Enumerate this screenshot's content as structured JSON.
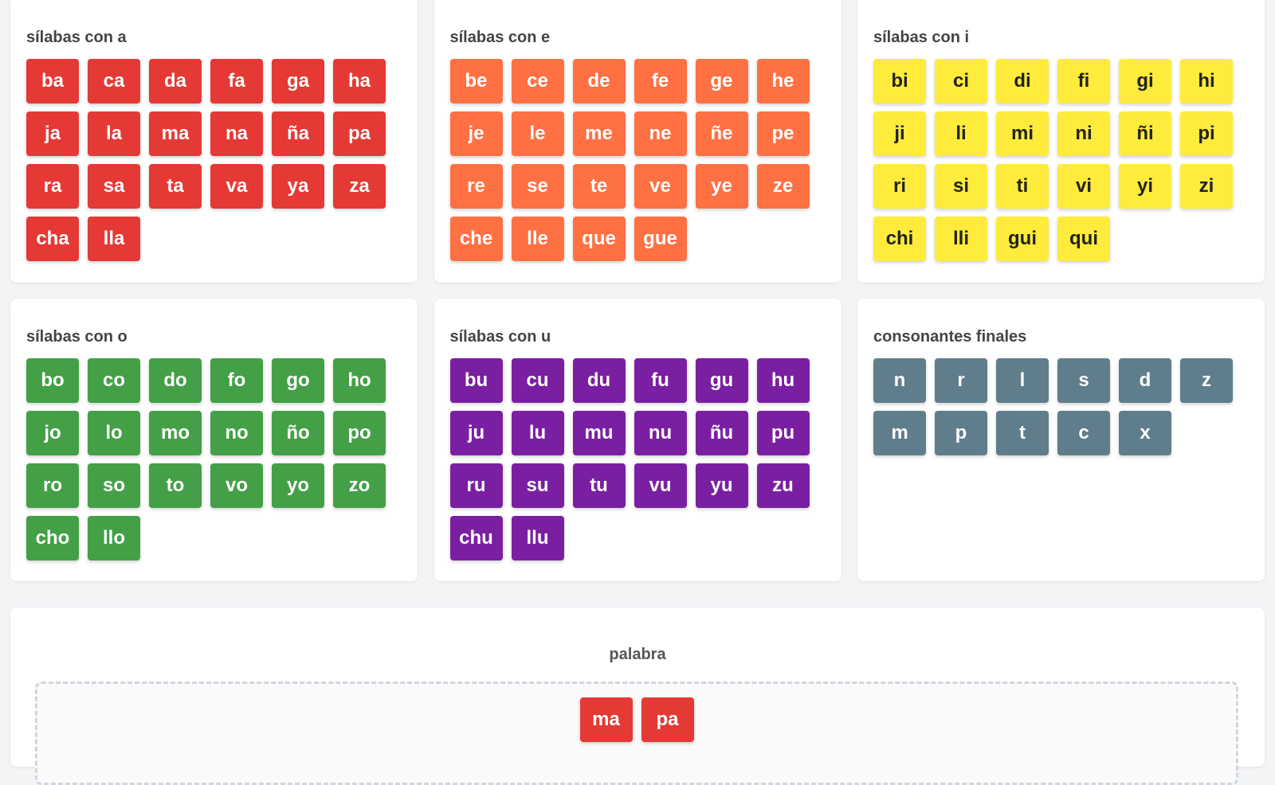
{
  "groups": [
    {
      "title": "sílabas con a",
      "color": "#e53935",
      "text_color": "#ffffff",
      "syllables": [
        "ba",
        "ca",
        "da",
        "fa",
        "ga",
        "ha",
        "ja",
        "la",
        "ma",
        "na",
        "ña",
        "pa",
        "ra",
        "sa",
        "ta",
        "va",
        "ya",
        "za",
        "cha",
        "lla"
      ]
    },
    {
      "title": "sílabas con e",
      "color": "#ff7043",
      "text_color": "#ffffff",
      "syllables": [
        "be",
        "ce",
        "de",
        "fe",
        "ge",
        "he",
        "je",
        "le",
        "me",
        "ne",
        "ñe",
        "pe",
        "re",
        "se",
        "te",
        "ve",
        "ye",
        "ze",
        "che",
        "lle",
        "que",
        "gue"
      ]
    },
    {
      "title": "sílabas con i",
      "color": "#ffeb3b",
      "text_color": "#222222",
      "syllables": [
        "bi",
        "ci",
        "di",
        "fi",
        "gi",
        "hi",
        "ji",
        "li",
        "mi",
        "ni",
        "ñi",
        "pi",
        "ri",
        "si",
        "ti",
        "vi",
        "yi",
        "zi",
        "chi",
        "lli",
        "gui",
        "qui"
      ]
    },
    {
      "title": "sílabas con o",
      "color": "#43a047",
      "text_color": "#ffffff",
      "syllables": [
        "bo",
        "co",
        "do",
        "fo",
        "go",
        "ho",
        "jo",
        "lo",
        "mo",
        "no",
        "ño",
        "po",
        "ro",
        "so",
        "to",
        "vo",
        "yo",
        "zo",
        "cho",
        "llo"
      ]
    },
    {
      "title": "sílabas con u",
      "color": "#7b1fa2",
      "text_color": "#ffffff",
      "syllables": [
        "bu",
        "cu",
        "du",
        "fu",
        "gu",
        "hu",
        "ju",
        "lu",
        "mu",
        "nu",
        "ñu",
        "pu",
        "ru",
        "su",
        "tu",
        "vu",
        "yu",
        "zu",
        "chu",
        "llu"
      ]
    },
    {
      "title": "consonantes finales",
      "color": "#607d8b",
      "text_color": "#ffffff",
      "syllables": [
        "n",
        "r",
        "l",
        "s",
        "d",
        "z",
        "m",
        "p",
        "t",
        "c",
        "x"
      ]
    }
  ],
  "word": {
    "title": "palabra",
    "tiles": [
      {
        "text": "ma",
        "color": "#e53935"
      },
      {
        "text": "pa",
        "color": "#e53935"
      }
    ]
  }
}
